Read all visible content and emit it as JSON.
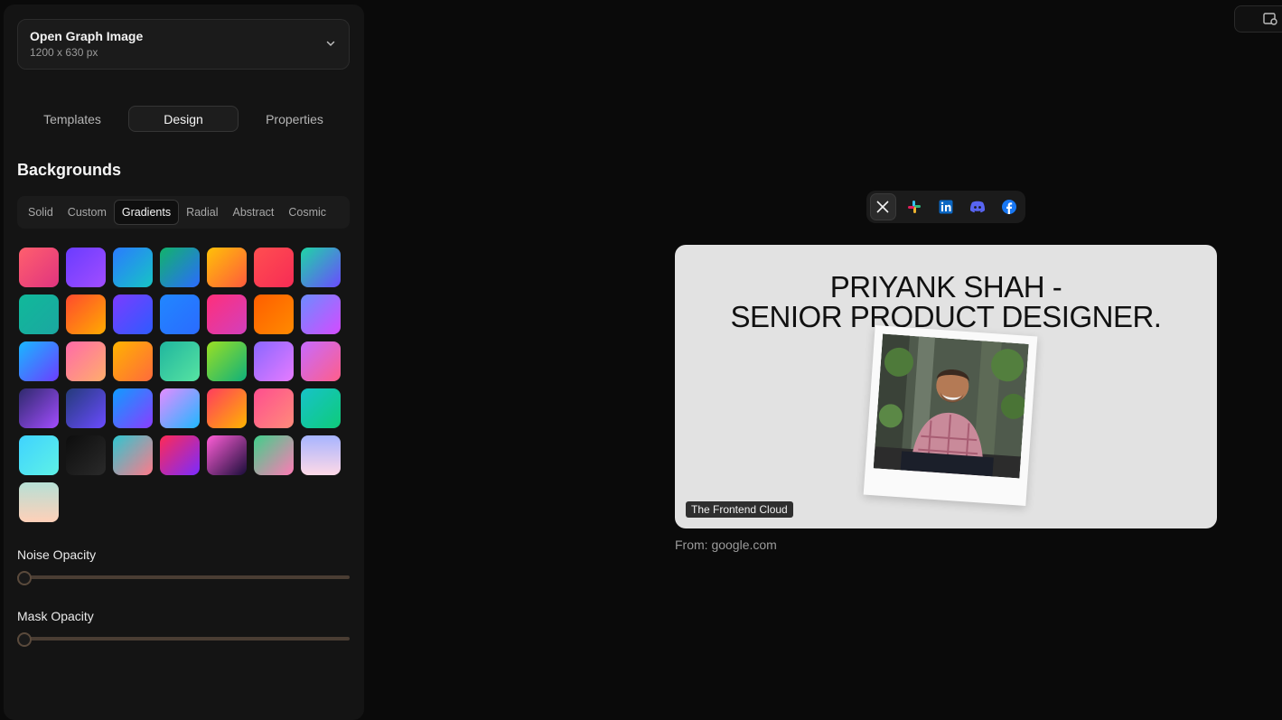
{
  "format": {
    "title": "Open Graph Image",
    "size": "1200 x 630 px"
  },
  "tabs": [
    "Templates",
    "Design",
    "Properties"
  ],
  "backgrounds": {
    "title": "Backgrounds",
    "tabs": [
      "Solid",
      "Custom",
      "Gradients",
      "Radial",
      "Abstract",
      "Cosmic"
    ],
    "swatches": [
      "linear-gradient(135deg,#ff5f6d,#e0347f)",
      "linear-gradient(135deg,#6a3cff,#a14dff)",
      "linear-gradient(135deg,#2a7bff,#17c4c4)",
      "linear-gradient(135deg,#11b36a,#2b6bff)",
      "linear-gradient(135deg,#ffc107,#ff5a3c)",
      "linear-gradient(135deg,#ff4e50,#f72c55)",
      "linear-gradient(135deg,#1ed6a5,#6b4bff)",
      "linear-gradient(135deg,#10b99a,#1ba7a1)",
      "linear-gradient(135deg,#ff4a2e,#ffab00)",
      "linear-gradient(135deg,#7b3cff,#2e5bff)",
      "linear-gradient(135deg,#2187ff,#2a6bff)",
      "linear-gradient(135deg,#ff2f7a,#d23fbd)",
      "linear-gradient(135deg,#ff5e00,#ff8a00)",
      "linear-gradient(135deg,#6c8cff,#d44bff)",
      "linear-gradient(135deg,#18b8ff,#6c3dff)",
      "linear-gradient(135deg,#ff6aa9,#ffae6b)",
      "linear-gradient(135deg,#ffb300,#ff6a3c)",
      "linear-gradient(135deg,#1fb69e,#57e3a2)",
      "linear-gradient(135deg,#9be023,#0fb07b)",
      "linear-gradient(135deg,#8a67ff,#e67bff)",
      "linear-gradient(135deg,#c66bff,#ff5e8a)",
      "linear-gradient(135deg,#2e2a6c,#a24cff)",
      "linear-gradient(135deg,#243b7a,#6a4bff)",
      "linear-gradient(135deg,#0f9cff,#8a3dff)",
      "linear-gradient(135deg,#e48cff,#1fb7ff)",
      "linear-gradient(135deg,#ff3c5f,#ffb400)",
      "linear-gradient(135deg,#ff4e8f,#ff8b7a)",
      "linear-gradient(135deg,#17c3c8,#0ecb7a)",
      "linear-gradient(135deg,#3fd3ff,#5ef1e6)",
      "linear-gradient(135deg,#0d0d0d,#2a2a2a)",
      "linear-gradient(135deg,#2ec6d0,#ff7a8a)",
      "linear-gradient(135deg,#ff2a55,#7a2bff)",
      "linear-gradient(135deg,#ff5ed7,#1a0d3a)",
      "linear-gradient(135deg,#3fd08a,#ff7ab5)",
      "linear-gradient(180deg,#a7b4ff,#ffd9e7)",
      "linear-gradient(180deg,#b7e0d6,#ffd0b8)"
    ]
  },
  "sliders": [
    {
      "label": "Noise Opacity",
      "value": 0
    },
    {
      "label": "Mask Opacity",
      "value": 0
    }
  ],
  "share_icons": [
    "x-icon",
    "slack-icon",
    "linkedin-icon",
    "discord-icon",
    "facebook-icon"
  ],
  "og_card": {
    "title_line1": "PRIYANK SHAH -",
    "title_line2": "SENIOR PRODUCT DESIGNER.",
    "badge": "The Frontend Cloud",
    "background": "#e2e2e2"
  },
  "from": "From: google.com"
}
